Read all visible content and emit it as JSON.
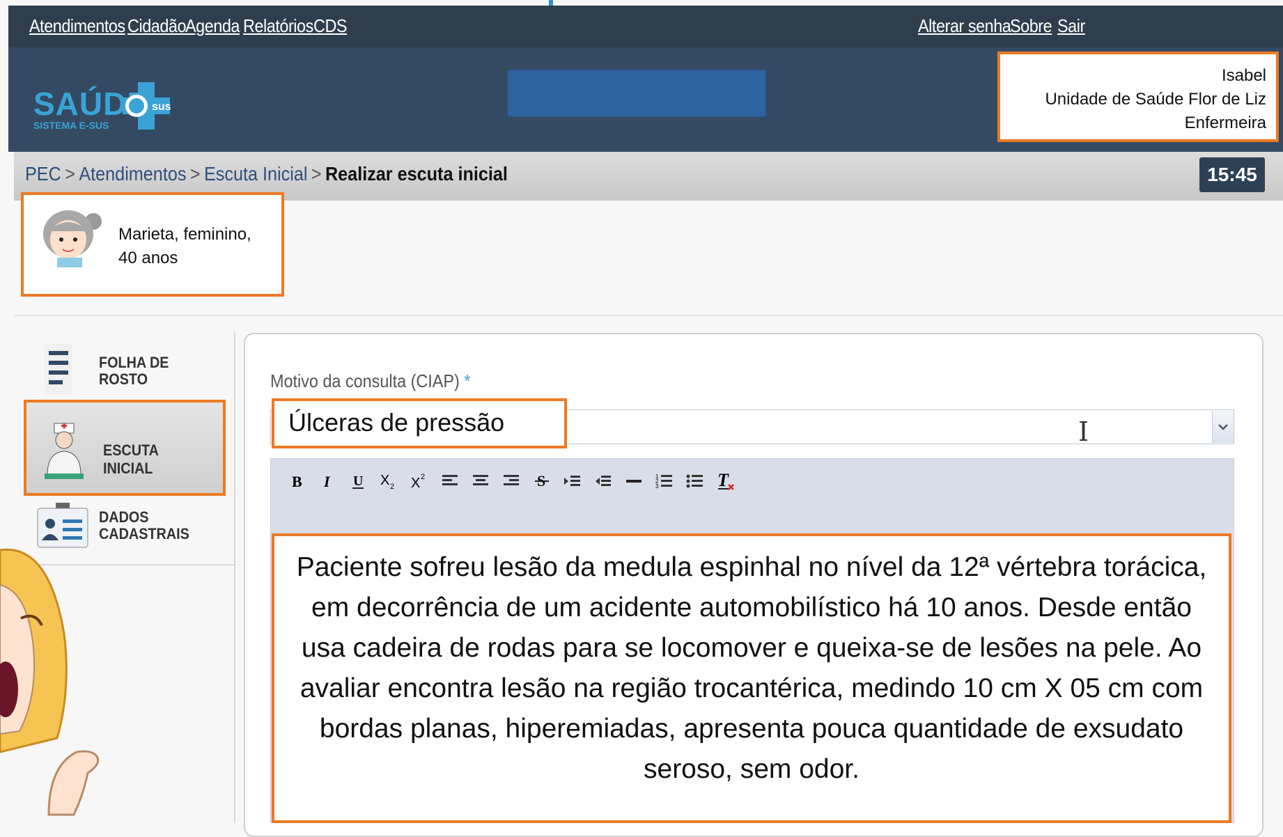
{
  "topnav": {
    "left": [
      "Atendimentos",
      "Cidadão",
      "Agenda",
      "Relatórios",
      "CDS"
    ],
    "right": [
      "Alterar senha",
      "Sobre",
      "Sair"
    ]
  },
  "logo": {
    "main": "SAÚDE",
    "sub": "SISTEMA E-SUS",
    "badge": "sus"
  },
  "user": {
    "name": "Isabel",
    "unit": "Unidade de Saúde Flor de Liz",
    "role": "Enfermeira"
  },
  "breadcrumb": [
    "PEC",
    "Atendimentos",
    "Escuta Inicial",
    "Realizar escuta inicial"
  ],
  "breadcrumb_sep": ">",
  "clock": "15:45",
  "patient": {
    "line1": "Marieta, feminino,",
    "line2": "40 anos"
  },
  "sidebar": [
    {
      "line1": "FOLHA DE",
      "line2": "ROSTO",
      "icon": "document-icon"
    },
    {
      "line1": "ESCUTA INICIAL",
      "line2": "",
      "icon": "nurse-icon",
      "active": true
    },
    {
      "line1": "DADOS",
      "line2": "CADASTRAIS",
      "icon": "id-card-icon"
    }
  ],
  "form": {
    "motivo_label": "Motivo da consulta (CIAP)",
    "required_mark": "*",
    "ciap_value": "Úlceras de pressão",
    "note": "Paciente sofreu lesão da medula espinhal no nível da 12ª vértebra torácica, em decorrência de um acidente automobilístico há 10 anos. Desde então usa cadeira de rodas para se locomover e queixa-se de lesões na pele. Ao avaliar encontra lesão na região trocantérica, medindo 10 cm X 05 cm com bordas planas, hiperemiadas, apresenta pouca quantidade de exsudato seroso, sem odor."
  },
  "toolbar": [
    "bold-icon",
    "italic-icon",
    "underline-icon",
    "subscript-icon",
    "superscript-icon",
    "align-left-icon",
    "align-center-icon",
    "align-right-icon",
    "strikethrough-icon",
    "indent-icon",
    "outdent-icon",
    "horizontal-rule-icon",
    "ordered-list-icon",
    "unordered-list-icon",
    "clear-format-icon"
  ],
  "colors": {
    "accent": "#ec7a24",
    "topbar": "#2f3e4d",
    "header": "#344a63",
    "brand": "#3aa3d6"
  }
}
